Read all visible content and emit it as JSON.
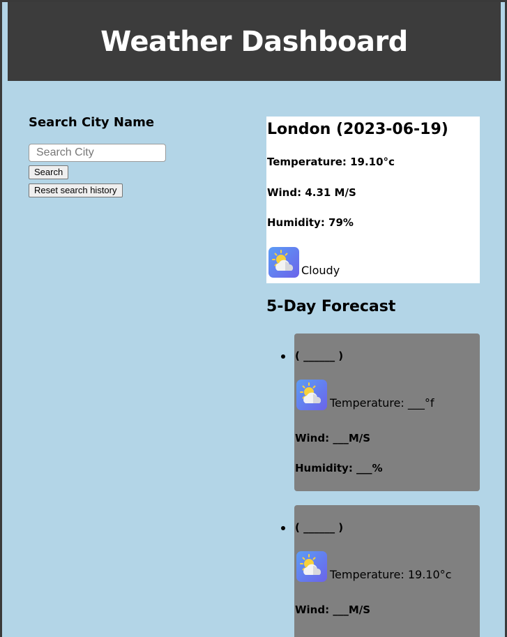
{
  "header": {
    "title": "Weather Dashboard"
  },
  "search": {
    "heading": "Search City Name",
    "placeholder": "Search City",
    "search_label": "Search",
    "reset_label": "Reset search history"
  },
  "current": {
    "title": "London (2023-06-19)",
    "temperature": "Temperature: 19.10°c",
    "wind": "Wind: 4.31 M/S",
    "humidity": "Humidity: 79%",
    "icon": "partly-cloudy-icon",
    "description": "Cloudy"
  },
  "forecast": {
    "title": "5-Day Forecast",
    "cards": [
      {
        "date": "( ______ )",
        "icon": "partly-cloudy-icon",
        "temperature": "Temperature: ___°f",
        "wind": "Wind: ___M/S",
        "humidity": "Humidity: ___%"
      },
      {
        "date": "( ______ )",
        "icon": "partly-cloudy-icon",
        "temperature": "Temperature: 19.10°c",
        "wind": "Wind: ___M/S",
        "humidity": ""
      }
    ]
  }
}
